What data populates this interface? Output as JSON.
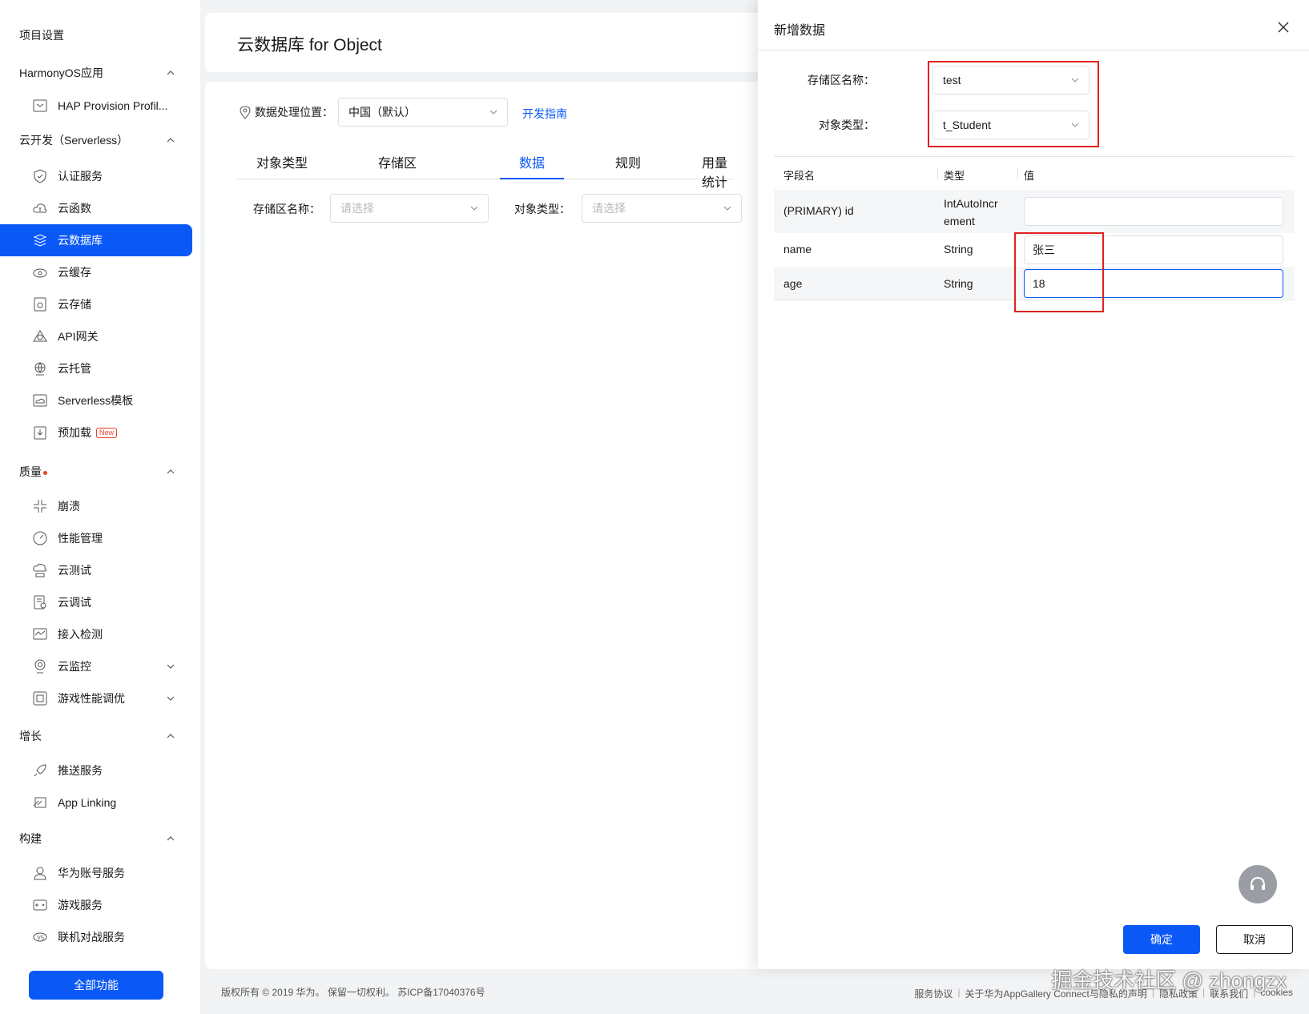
{
  "sidebar": {
    "project_settings": "项目设置",
    "groups": {
      "harmony": "HarmonyOS应用",
      "serverless": "云开发（Serverless）",
      "quality": "质量",
      "growth": "增长",
      "build": "构建"
    },
    "items": {
      "hap": "HAP Provision Profil...",
      "auth": "认证服务",
      "func": "云函数",
      "db": "云数据库",
      "cache": "云缓存",
      "storage": "云存储",
      "api": "API网关",
      "hosting": "云托管",
      "serverless_tpl": "Serverless模板",
      "preload": "预加载",
      "crash": "崩溃",
      "perf": "性能管理",
      "cloudtest": "云测试",
      "clouddebug": "云调试",
      "access": "接入检测",
      "monitor": "云监控",
      "gameperf": "游戏性能调优",
      "push": "推送服务",
      "applinking": "App Linking",
      "account": "华为账号服务",
      "game": "游戏服务",
      "multiplayer": "联机对战服务"
    },
    "new_badge": "New",
    "all_functions": "全部功能"
  },
  "main": {
    "title": "云数据库 for Object",
    "location_label": "数据处理位置：",
    "location_value": "中国（默认）",
    "dev_guide": "开发指南",
    "tabs": [
      "对象类型",
      "存储区",
      "数据",
      "规则",
      "用量统计"
    ],
    "zone_label": "存储区名称：",
    "zone_placeholder": "请选择",
    "type_label": "对象类型：",
    "type_placeholder": "请选择"
  },
  "drawer": {
    "title": "新增数据",
    "zone_label": "存储区名称：",
    "zone_value": "test",
    "type_label": "对象类型：",
    "type_value": "t_Student",
    "headers": [
      "字段名",
      "类型",
      "值"
    ],
    "rows": [
      {
        "field": "(PRIMARY) id",
        "type_l1": "IntAutoIncr",
        "type_l2": "ement",
        "value": ""
      },
      {
        "field": "name",
        "type": "String",
        "value": "张三"
      },
      {
        "field": "age",
        "type": "String",
        "value": "18"
      }
    ],
    "ok": "确定",
    "cancel": "取消"
  },
  "footer": {
    "copyright": "版权所有 © 2019 华为。 保留一切权利。 苏ICP备17040376号",
    "links": [
      "服务协议",
      "关于华为AppGallery Connect与隐私的声明",
      "隐私政策",
      "联系我们",
      "cookies"
    ]
  },
  "watermark": "掘金技术社区 @ zhongzx",
  "colors": {
    "accent": "#0a59f7",
    "highlight": "#e02020"
  }
}
